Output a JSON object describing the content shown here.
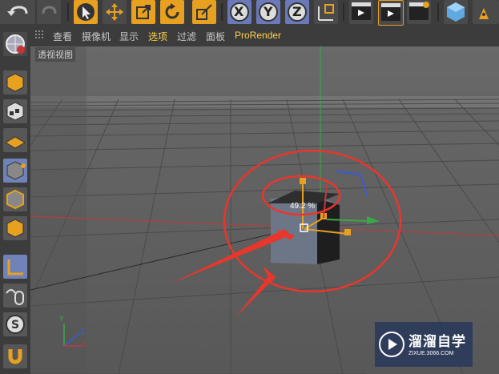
{
  "menu": {
    "items": [
      {
        "label": "查看"
      },
      {
        "label": "摄像机"
      },
      {
        "label": "显示"
      },
      {
        "label": "选项"
      },
      {
        "label": "过滤"
      },
      {
        "label": "面板"
      },
      {
        "label": "ProRender"
      }
    ]
  },
  "viewport": {
    "label": "透视视图",
    "scale_readout": "49.2 %"
  },
  "axis_indicator": {
    "y": "Y",
    "z": "Z",
    "x": "X"
  },
  "toolbar": {
    "axis_x": "X",
    "axis_y": "Y",
    "axis_z": "Z"
  },
  "watermark": {
    "title": "溜溜自学",
    "url": "ZIXUE.3066.COM"
  },
  "colors": {
    "accent": "#e8a020",
    "active_tool": "#6f83b8",
    "annotation": "#e8362c"
  }
}
